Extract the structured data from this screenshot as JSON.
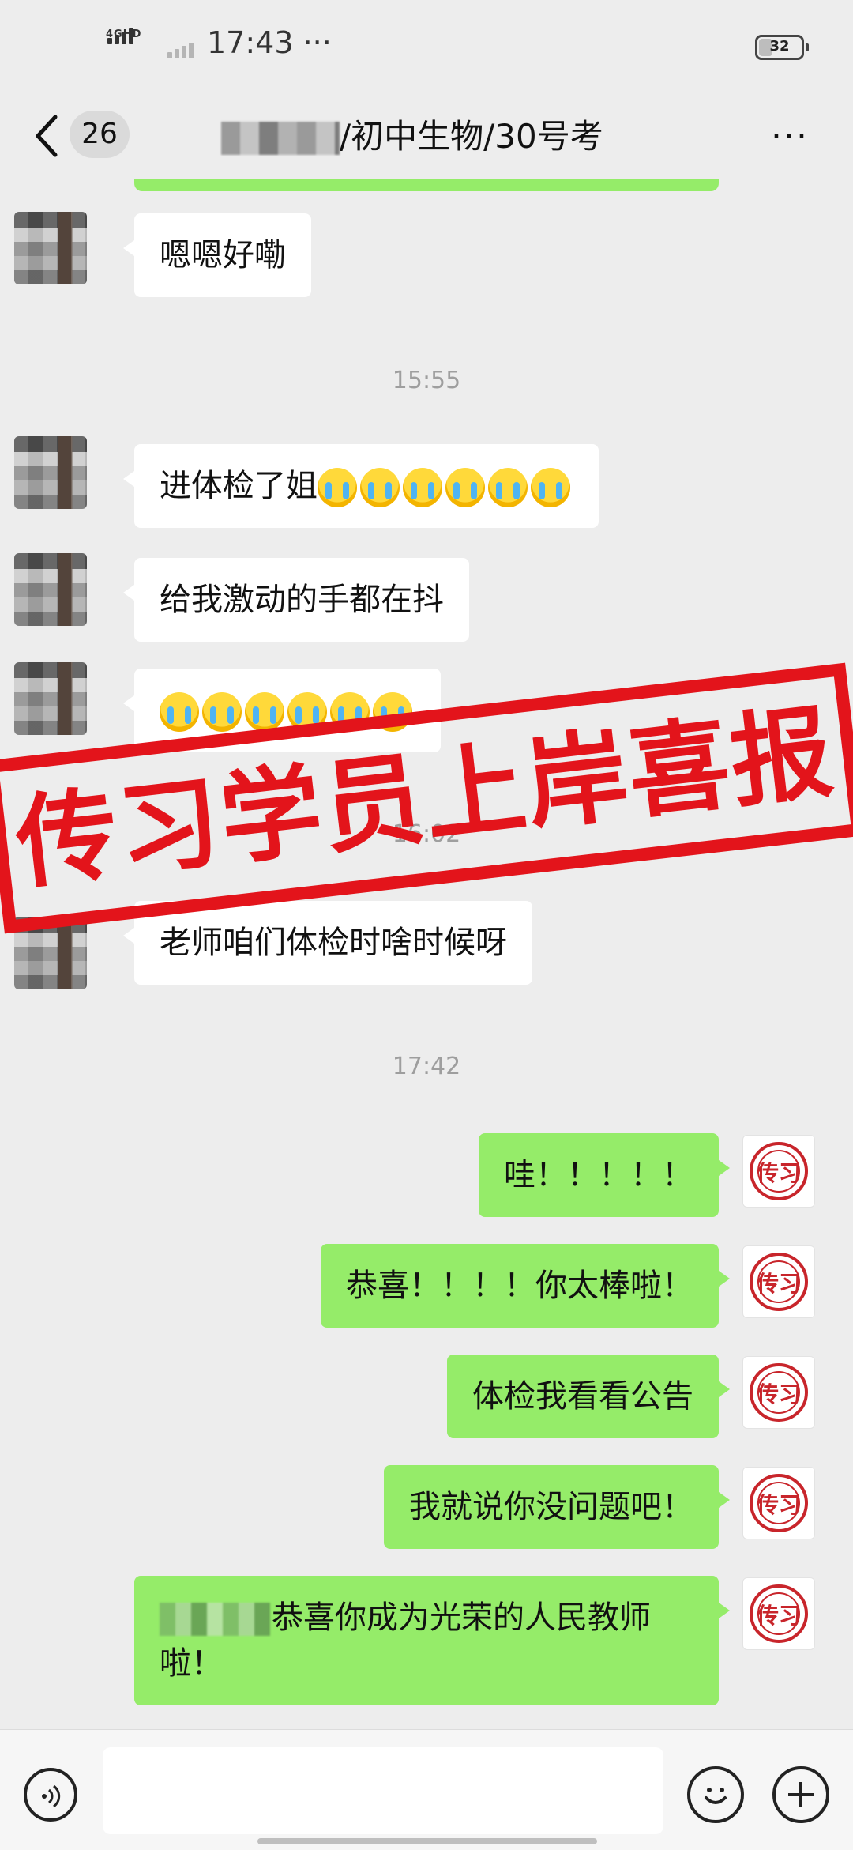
{
  "status_bar": {
    "network_label": "4GHD",
    "time": "17:43 ···",
    "battery": "32",
    "battery_level_percent": 32
  },
  "nav": {
    "unread_count": "26",
    "title": "/初中生物/30号考",
    "more": "···"
  },
  "messages": [
    {
      "side": "in",
      "text": "嗯嗯好嘞"
    },
    {
      "type": "time",
      "text": "15:55"
    },
    {
      "side": "in",
      "text": "进体检了姐",
      "emoji": "crying-face",
      "emoji_count": 6
    },
    {
      "side": "in",
      "text": "给我激动的手都在抖"
    },
    {
      "side": "in",
      "text": "",
      "emoji": "crying-face",
      "emoji_count": 6
    },
    {
      "type": "time",
      "text": "16:02"
    },
    {
      "side": "in",
      "text": "老师咱们体检时啥时候呀"
    },
    {
      "type": "time",
      "text": "17:42"
    },
    {
      "side": "out",
      "text": "哇！！！！！"
    },
    {
      "side": "out",
      "text": "恭喜！！！！你太棒啦！"
    },
    {
      "side": "out",
      "text": "体检我看看公告"
    },
    {
      "side": "out",
      "text": "我就说你没问题吧！"
    },
    {
      "side": "out",
      "text": "恭喜你成为光荣的人民教师啦！"
    }
  ],
  "overlay_banner": "传习学员上岸喜报",
  "seal_glyph": "传习",
  "colors": {
    "background": "#ededed",
    "outgoing_bubble": "#95ec69",
    "incoming_bubble": "#ffffff",
    "banner_red": "#e3141b",
    "seal_red": "#c8252b"
  },
  "icons": [
    "back-chevron-icon",
    "more-icon",
    "voice-icon",
    "emoji-icon",
    "plus-icon",
    "crying-face-emoji"
  ]
}
